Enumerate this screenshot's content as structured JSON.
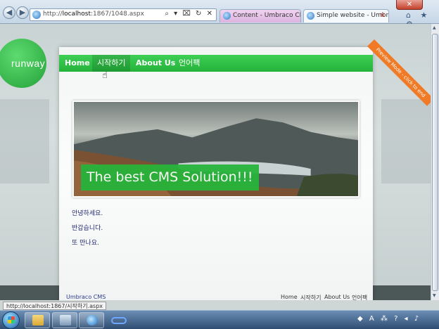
{
  "browser": {
    "url_prefix": "http://",
    "url_host": "localhost",
    "url_rest": ":1867/1048.aspx",
    "address_tools": "⌕ ▾ ⌧ ↻ ✕",
    "tabs": [
      {
        "label": "Content - Umbraco CMS - lo..."
      },
      {
        "label": "Simple website - Umbraco..."
      }
    ],
    "tab_close": "✕",
    "window_close": "✕",
    "toolbar_icons": "⌂ ★ ⚙"
  },
  "site": {
    "logo": "runway",
    "menu": [
      {
        "label": "Home"
      },
      {
        "label": "시작하기"
      },
      {
        "label": "About Us"
      },
      {
        "label": "언어팩"
      }
    ],
    "hero_caption": "The best CMS Solution!!!",
    "paragraphs": [
      "안녕하세요.",
      "반갑습니다.",
      "또 만나요."
    ],
    "footer": {
      "brand": "Umbraco CMS",
      "links": [
        "Home",
        "시작하기",
        "About Us",
        "언어팩"
      ]
    },
    "preview_ribbon": "Preview Mode - click to end"
  },
  "status_bar": {
    "url": "http://localhost:1867/시작하기.aspx"
  },
  "taskbar": {
    "tray": "◆ A ⁂ ? ◂ ♪"
  },
  "colors": {
    "brand_green": "#27b43a",
    "ribbon_orange": "#f07a25",
    "text_blue": "#222a70"
  }
}
